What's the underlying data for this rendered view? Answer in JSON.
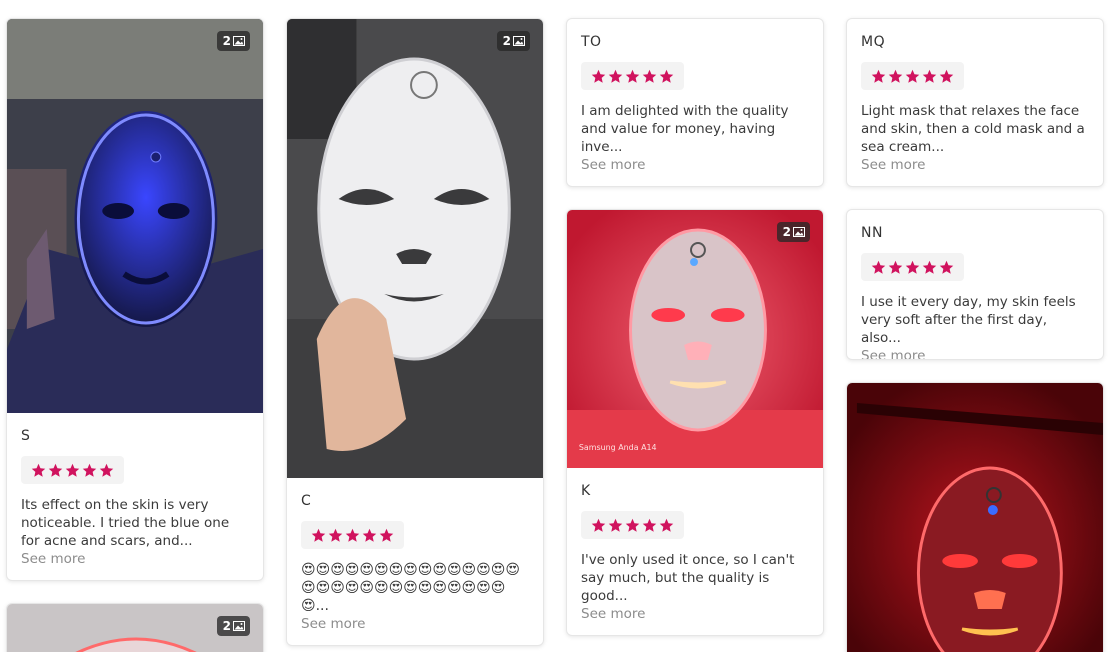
{
  "colors": {
    "star": "#d0135e",
    "star_bg": "#f3f3f3",
    "see_more": "#8c8c8c"
  },
  "badge_icon": "image-gallery-icon",
  "star_icon": "star-icon",
  "reviews": [
    {
      "author": "S",
      "rating": 5,
      "photos": "2",
      "text": "Its effect on the skin is very noticeable. I tried the blue one for acne and scars, and...",
      "see_more": "See more"
    },
    {
      "author": "C",
      "rating": 5,
      "photos": "2",
      "text": "😍😍😍😍😍😍😍😍😍😍😍😍😍😍😍😍😍😍😍😍😍😍😍😍😍😍😍😍😍😍...",
      "see_more": "See more"
    },
    {
      "author": "TO",
      "rating": 5,
      "text": "I am delighted with the quality and value for money, having inve...",
      "see_more": "See more"
    },
    {
      "author": "K",
      "rating": 5,
      "photos": "2",
      "text": "I've only used it once, so I can't say much, but the quality is good...",
      "see_more": "See more"
    },
    {
      "author": "MQ",
      "rating": 5,
      "text": "Light mask that relaxes the face and skin, then a cold mask and a sea cream...",
      "see_more": "See more"
    },
    {
      "author": "NN",
      "rating": 5,
      "text": "I use it every day, my skin feels very soft after the first day, also...",
      "see_more": "See more"
    },
    {
      "photos": "2"
    }
  ],
  "photo_watermark": "Samsung Anda A14"
}
